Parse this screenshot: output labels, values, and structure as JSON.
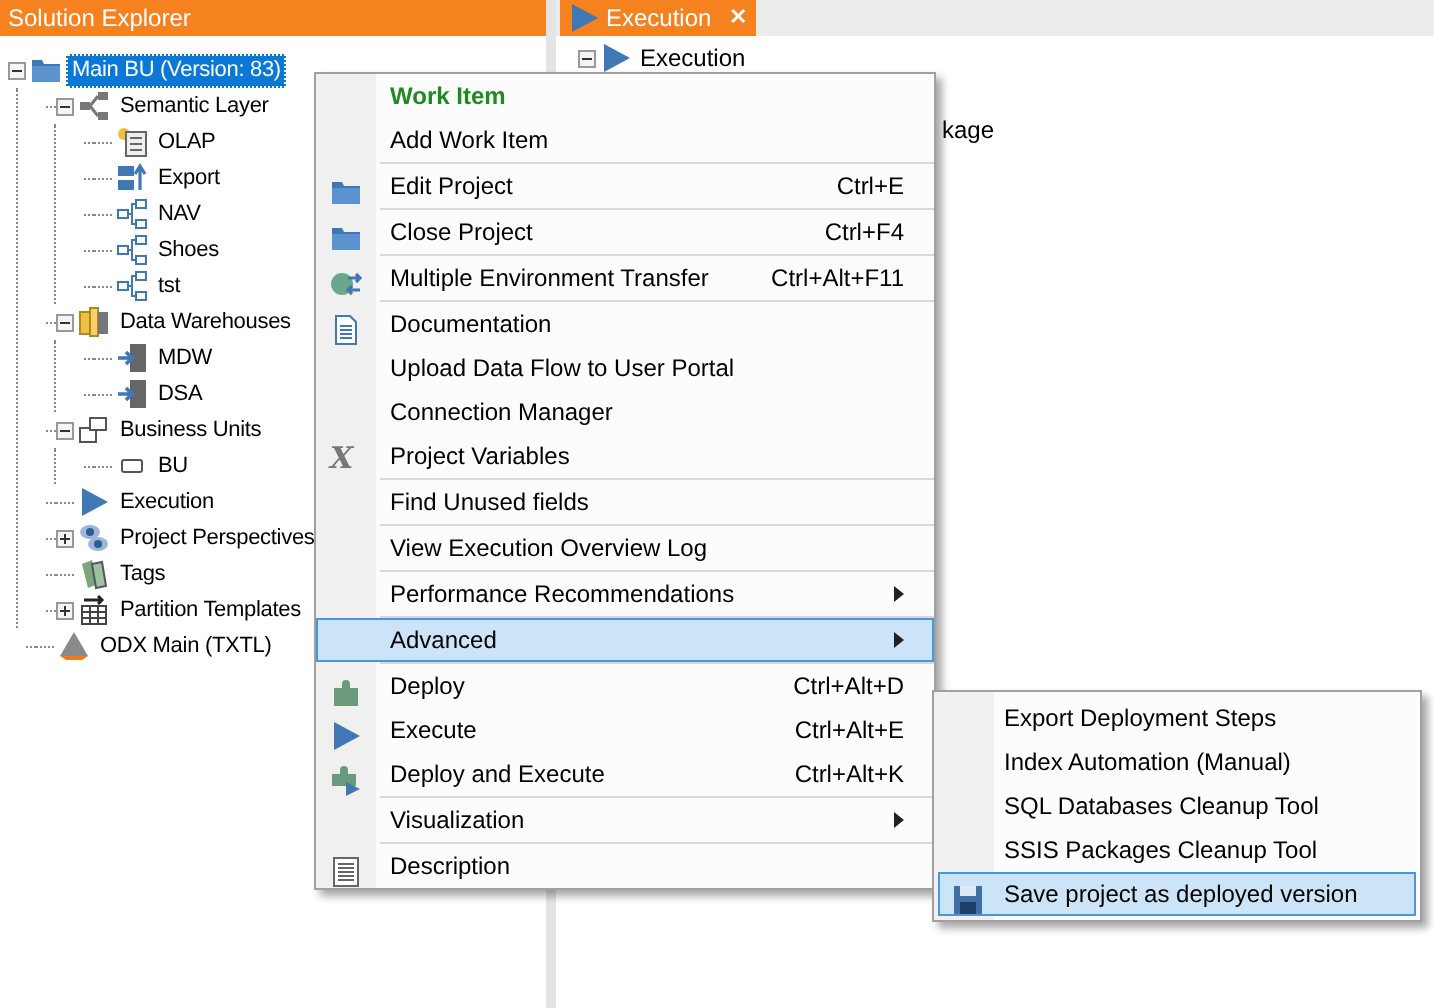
{
  "solution_explorer": {
    "title": "Solution Explorer",
    "tree": [
      {
        "label": "Main BU (Version: 83)",
        "kind": "folder",
        "expanded": true,
        "selected": true,
        "children": [
          {
            "label": "Semantic Layer",
            "kind": "semantic",
            "expanded": true,
            "selected": false,
            "children": [
              {
                "label": "OLAP",
                "kind": "cube",
                "selected": false
              },
              {
                "label": "Export",
                "kind": "export",
                "selected": false
              },
              {
                "label": "NAV",
                "kind": "model",
                "selected": false
              },
              {
                "label": "Shoes",
                "kind": "model",
                "selected": false
              },
              {
                "label": "tst",
                "kind": "model",
                "selected": false
              }
            ]
          },
          {
            "label": "Data Warehouses",
            "kind": "warehouse",
            "expanded": true,
            "selected": false,
            "children": [
              {
                "label": "MDW",
                "kind": "table",
                "selected": false
              },
              {
                "label": "DSA",
                "kind": "table",
                "selected": false
              }
            ]
          },
          {
            "label": "Business Units",
            "kind": "units",
            "expanded": true,
            "selected": false,
            "children": [
              {
                "label": "BU",
                "kind": "unit",
                "selected": false
              }
            ]
          },
          {
            "label": "Execution",
            "kind": "play",
            "selected": false
          },
          {
            "label": "Project Perspectives",
            "kind": "perspective",
            "expanded": false,
            "selected": false
          },
          {
            "label": "Tags",
            "kind": "tags",
            "selected": false
          },
          {
            "label": "Partition Templates",
            "kind": "partition",
            "expanded": false,
            "selected": false
          }
        ]
      },
      {
        "label": "ODX Main (TXTL)",
        "kind": "odx",
        "selected": false
      }
    ]
  },
  "tabs": [
    {
      "label": "Execution",
      "close": "✕",
      "selected": true
    }
  ],
  "execution_pane": {
    "rows": [
      {
        "label": "Execution",
        "kind": "play"
      },
      {
        "label": "kage",
        "kind": "text"
      }
    ]
  },
  "context_menu": {
    "groups": [
      [
        {
          "label": "Work Item",
          "kind": "header"
        },
        {
          "label": "Add Work Item",
          "kind": "none"
        }
      ],
      [
        {
          "label": "Edit Project",
          "kind": "folder",
          "shortcut": "Ctrl+E"
        }
      ],
      [
        {
          "label": "Close Project",
          "kind": "folder",
          "shortcut": "Ctrl+F4"
        }
      ],
      [
        {
          "label": "Multiple Environment Transfer",
          "kind": "transfer",
          "shortcut": "Ctrl+Alt+F11"
        }
      ],
      [
        {
          "label": "Documentation",
          "kind": "document"
        },
        {
          "label": "Upload Data Flow to User Portal",
          "kind": "none"
        },
        {
          "label": "Connection Manager",
          "kind": "none"
        },
        {
          "label": "Project Variables",
          "kind": "variable",
          "icon_text": "X"
        }
      ],
      [
        {
          "label": "Find Unused fields",
          "kind": "none"
        }
      ],
      [
        {
          "label": "View Execution Overview Log",
          "kind": "none"
        }
      ],
      [
        {
          "label": "Performance Recommendations",
          "kind": "none",
          "submenu": true,
          "selected": false
        }
      ],
      [
        {
          "label": "Advanced",
          "kind": "none",
          "submenu": true,
          "selected": true
        }
      ],
      [
        {
          "label": "Deploy",
          "kind": "deploy",
          "shortcut": "Ctrl+Alt+D"
        },
        {
          "label": "Execute",
          "kind": "play",
          "shortcut": "Ctrl+Alt+E"
        },
        {
          "label": "Deploy and Execute",
          "kind": "deployexec",
          "shortcut": "Ctrl+Alt+K"
        }
      ],
      [
        {
          "label": "Visualization",
          "kind": "none",
          "submenu": true,
          "selected": false
        }
      ],
      [
        {
          "label": "Description",
          "kind": "description"
        }
      ]
    ]
  },
  "advanced_submenu": {
    "items": [
      {
        "label": "Export Deployment Steps",
        "kind": "none",
        "selected": false
      },
      {
        "label": "Index Automation (Manual)",
        "kind": "none",
        "selected": false
      },
      {
        "label": "SQL Databases Cleanup Tool",
        "kind": "none",
        "selected": false
      },
      {
        "label": "SSIS Packages Cleanup Tool",
        "kind": "none",
        "selected": false
      },
      {
        "label": "Save project as deployed version",
        "kind": "save",
        "selected": true
      }
    ]
  }
}
